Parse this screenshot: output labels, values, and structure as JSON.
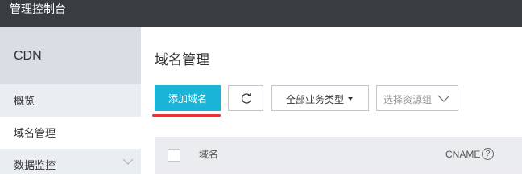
{
  "header": {
    "title": "管理控制台"
  },
  "sidebar": {
    "product": "CDN",
    "items": [
      {
        "label": "概览",
        "active": false
      },
      {
        "label": "域名管理",
        "active": true
      },
      {
        "label": "数据监控",
        "active": false,
        "has_chevron": true
      }
    ]
  },
  "main": {
    "title": "域名管理",
    "toolbar": {
      "add_label": "添加域名",
      "refresh_icon": "refresh-icon",
      "type_select_value": "全部业务类型",
      "group_select_placeholder": "选择资源组"
    },
    "table": {
      "columns": [
        "域名",
        "CNAME"
      ],
      "help_icon": "?"
    }
  },
  "colors": {
    "topbar": "#373d41",
    "accent": "#19b4d7",
    "highlight": "#e8333a",
    "sidebar_bg": "#eaedf1"
  }
}
